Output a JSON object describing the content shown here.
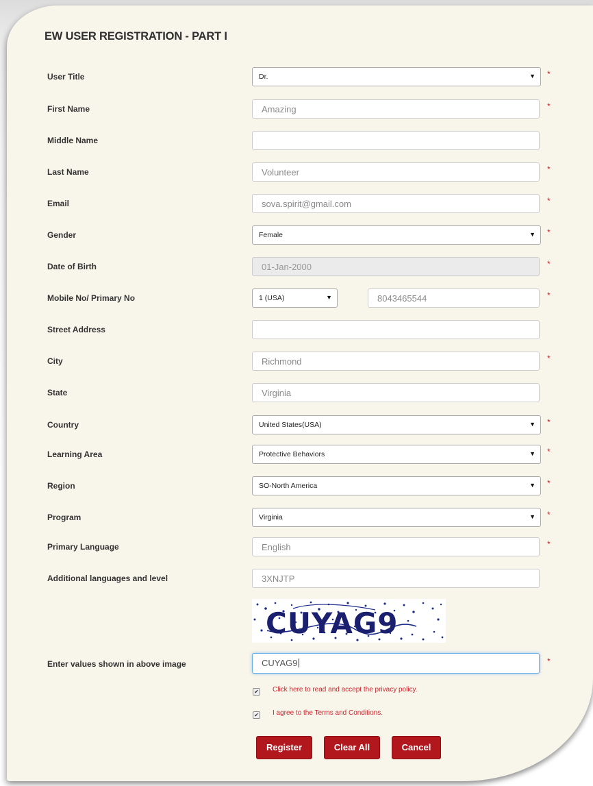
{
  "page": {
    "title": "EW USER REGISTRATION - PART I"
  },
  "required_mark": "*",
  "fields": {
    "user_title": {
      "label": "User Title",
      "value": "Dr."
    },
    "first_name": {
      "label": "First Name",
      "value": "Amazing"
    },
    "middle_name": {
      "label": "Middle Name",
      "value": ""
    },
    "last_name": {
      "label": "Last Name",
      "value": "Volunteer"
    },
    "email": {
      "label": "Email",
      "value": "sova.spirit@gmail.com"
    },
    "gender": {
      "label": "Gender",
      "value": "Female"
    },
    "dob": {
      "label": "Date of Birth",
      "value": "01-Jan-2000"
    },
    "mobile": {
      "label": "Mobile No/ Primary No",
      "code": "1 (USA)",
      "value": "8043465544"
    },
    "street": {
      "label": "Street Address",
      "value": ""
    },
    "city": {
      "label": "City",
      "value": "Richmond"
    },
    "state": {
      "label": "State",
      "value": "Virginia"
    },
    "country": {
      "label": "Country",
      "value": "United States(USA)"
    },
    "learning_area": {
      "label": "Learning Area",
      "value": "Protective Behaviors"
    },
    "region": {
      "label": "Region",
      "value": "SO-North America"
    },
    "program": {
      "label": "Program",
      "value": "Virginia"
    },
    "primary_language": {
      "label": "Primary Language",
      "value": "English"
    },
    "additional_languages": {
      "label": "Additional languages and level",
      "value": "3XNJTP"
    },
    "captcha_entry": {
      "label": "Enter values shown in above image",
      "value": "CUYAG9"
    }
  },
  "captcha": {
    "text": "CUYAG9"
  },
  "checkboxes": {
    "privacy": {
      "label": "Click here to read and accept the privacy policy.",
      "checked": true
    },
    "terms": {
      "label": "I agree to the Terms and Conditions.",
      "checked": true
    }
  },
  "buttons": {
    "register": "Register",
    "clear_all": "Clear All",
    "cancel": "Cancel"
  },
  "icons": {
    "dropdown_arrow": "▼",
    "checkmark": "✔"
  },
  "colors": {
    "accent_red": "#b3171e",
    "required_red": "#c9252d",
    "card_bg": "#f8f5ea",
    "focus_blue": "#66afe9"
  }
}
